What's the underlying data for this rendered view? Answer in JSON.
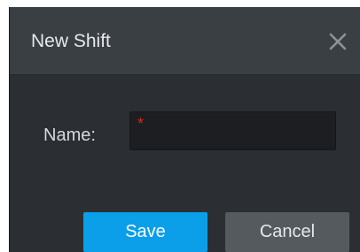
{
  "dialog": {
    "title": "New Shift",
    "close_icon": "close-icon"
  },
  "form": {
    "name_label": "Name:",
    "name_required_mark": "*",
    "name_value": ""
  },
  "buttons": {
    "save_label": "Save",
    "cancel_label": "Cancel"
  },
  "colors": {
    "accent": "#0a9fe8",
    "required": "#e2231a",
    "dialog_bg": "#2b2f33",
    "titlebar_bg": "#3a3f44",
    "secondary_button": "#555a5f"
  }
}
